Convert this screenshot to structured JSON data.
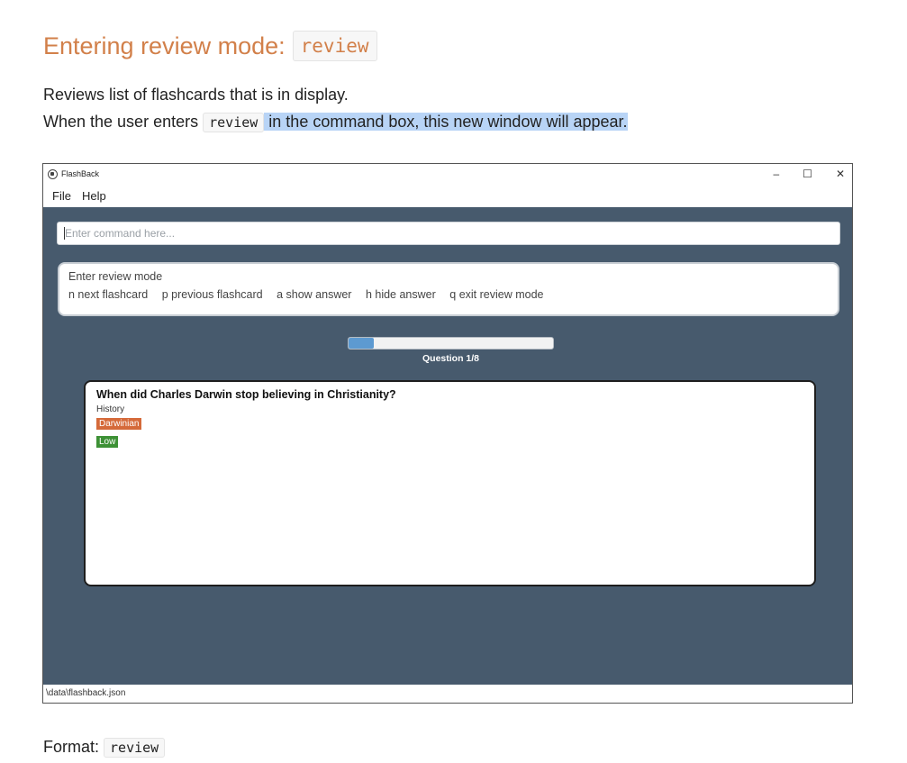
{
  "doc": {
    "heading_text": "Entering review mode:",
    "heading_code": "review",
    "para1": "Reviews list of flashcards that is in display.",
    "para2_before": "When the user enters",
    "para2_code": "review",
    "para2_after": " in the command box, this new window will appear.",
    "format_label": "Format:",
    "format_code": "review"
  },
  "app": {
    "title": "FlashBack",
    "controls": {
      "minimize": "–",
      "maximize": "☐",
      "close": "✕"
    },
    "menu": [
      "File",
      "Help"
    ],
    "command_placeholder": "Enter command here...",
    "result": {
      "title": "Enter review mode",
      "hints": [
        "n next flashcard",
        "p previous flashcard",
        "a show answer",
        "h hide answer",
        "q exit review mode"
      ]
    },
    "progress": {
      "fraction": 0.125,
      "label": "Question 1/8"
    },
    "card": {
      "question": "When did Charles Darwin stop believing in Christianity?",
      "category": "History",
      "tag": "Darwinian",
      "priority": "Low"
    },
    "status_path": "\\data\\flashback.json"
  },
  "colors": {
    "heading": "#d2804a",
    "panel_bg": "#475a6d",
    "progress": "#5d9ad1",
    "tag_orange": "#d56a3a",
    "tag_green": "#3d9135",
    "highlight": "#b8d4f6"
  }
}
